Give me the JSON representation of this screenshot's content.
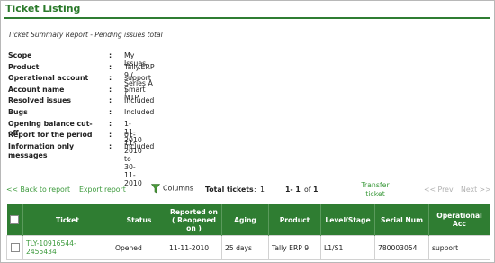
{
  "page": {
    "title": "Ticket Listing",
    "subtitle": "Ticket Summary Report - Pending issues total"
  },
  "info": [
    {
      "label": "Scope",
      "value": "My Issues"
    },
    {
      "label": "Product",
      "value": "Tally.ERP 9 ( Series A )"
    },
    {
      "label": "Operational account",
      "value": "support"
    },
    {
      "label": "Account name",
      "value": "Smart MTP"
    },
    {
      "label": "Resolved issues",
      "value": "Included"
    },
    {
      "label": "Bugs",
      "value": "Included"
    },
    {
      "label": "Opening balance cut-off",
      "value": "1-11-2010"
    },
    {
      "label": "Report for the period",
      "value": "01-11-2010 to 30-11-2010"
    },
    {
      "label": "Information only messages",
      "value": "Included"
    }
  ],
  "colon": ":",
  "toolbar": {
    "back": "<< Back to report",
    "export": "Export report",
    "columns": "Columns",
    "total_label": "Total tickets",
    "total_colon": ":",
    "total_value": "1",
    "range": "1- 1",
    "of": "of",
    "of_value": "1",
    "transfer_line1": "Transfer",
    "transfer_line2": "ticket",
    "prev": "<< Prev",
    "next": "Next >>"
  },
  "table": {
    "headers": {
      "ticket": "Ticket",
      "status": "Status",
      "reported_line1": "Reported on",
      "reported_line2": "( Reopened",
      "reported_line3": "on )",
      "aging": "Aging",
      "product": "Product",
      "level": "Level/Stage",
      "serial": "Serial Num",
      "opacc_line1": "Operational",
      "opacc_line2": "Acc"
    },
    "rows": [
      {
        "ticket_line1": "TLY-10916544-",
        "ticket_line2": "2455434",
        "status": "Opened",
        "reported": "11-11-2010",
        "aging": "25 days",
        "product": "Tally ERP 9",
        "level": "L1/S1",
        "serial": "780003054",
        "opacc": "support"
      }
    ]
  },
  "colors": {
    "accent": "#2f7d32",
    "link": "#3c9a3c",
    "title": "#2b7a2b"
  },
  "icons": [
    "funnel-icon",
    "checkbox-icon"
  ]
}
